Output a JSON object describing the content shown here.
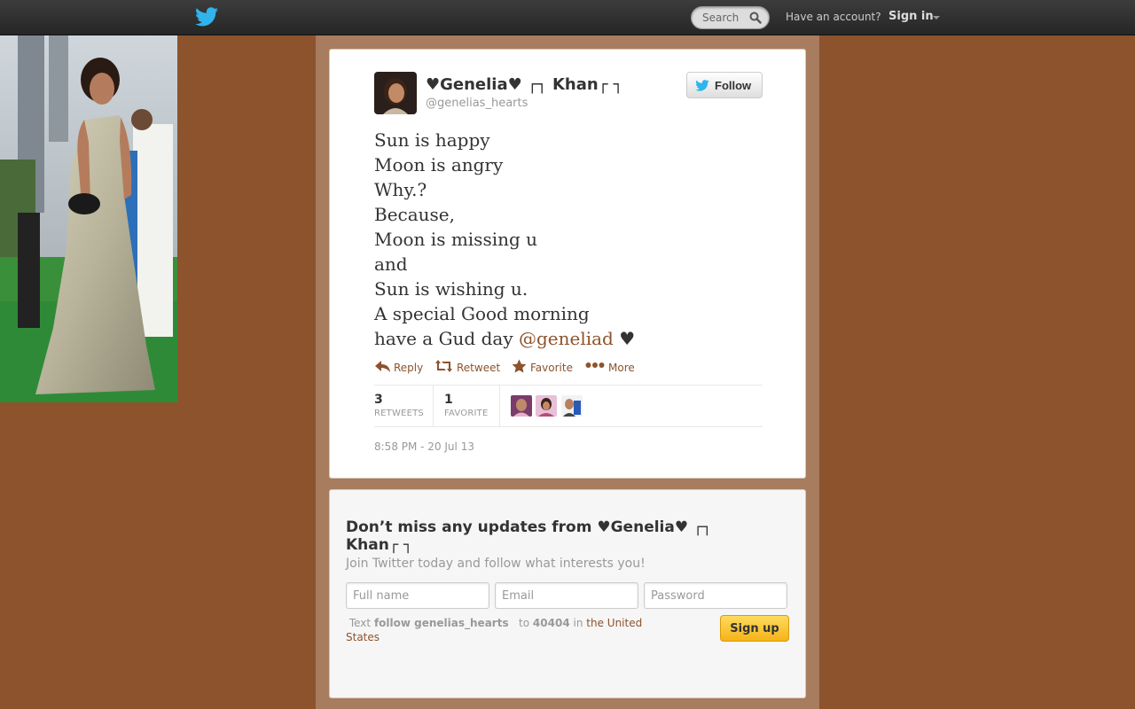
{
  "topbar": {
    "search_placeholder": "Search",
    "have_account": "Have an account?",
    "signin_label": "Sign in"
  },
  "tweet": {
    "display_name": "♥Genelia♥ ┌┐ Khan┌ ┐",
    "handle": "@genelias_hearts",
    "follow_label": "Follow",
    "text_lines": [
      "Sun is happy",
      "Moon is angry",
      "Why.?",
      "Because,",
      "Moon is missing u",
      "and",
      "Sun is wishing u.",
      "A special Good morning"
    ],
    "last_line_prefix": "have a Gud day ",
    "mention": "@geneliad",
    "last_line_suffix": " ♥",
    "actions": {
      "reply": "Reply",
      "retweet": "Retweet",
      "favorite": "Favorite",
      "more": "More"
    },
    "stats": {
      "retweets_count": "3",
      "retweets_label": "RETWEETS",
      "favorites_count": "1",
      "favorites_label": "FAVORITE"
    },
    "timestamp": "8:58 PM - 20 Jul 13"
  },
  "signup": {
    "title": "Don’t miss any updates from ♥Genelia♥ ┌┐ Khan┌ ┐",
    "subtitle": "Join Twitter today and follow what interests you!",
    "fullname_placeholder": "Full name",
    "email_placeholder": "Email",
    "password_placeholder": "Password",
    "sms_text": "Text",
    "sms_command": "follow genelias_hearts",
    "sms_to": "to",
    "sms_number": "40404",
    "sms_in": "in",
    "sms_country": "the United States",
    "signup_label": "Sign up"
  },
  "colors": {
    "background": "#8c532c",
    "link": "#8c532c",
    "column": "#a87c5e"
  }
}
